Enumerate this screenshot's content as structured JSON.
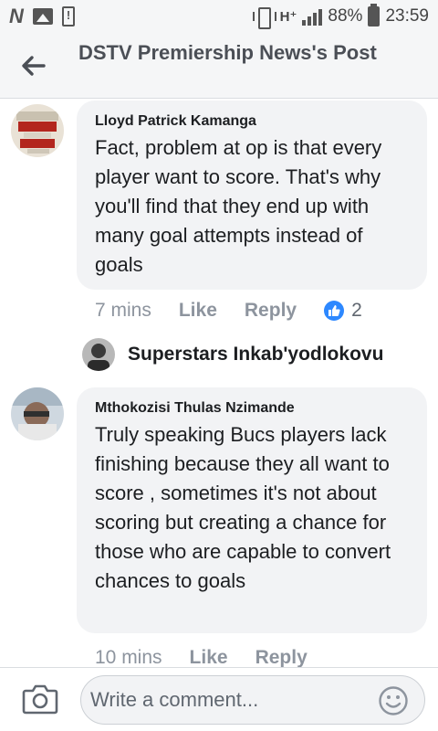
{
  "status_bar": {
    "n_icon": "N",
    "network": "H⁺",
    "battery": "88%",
    "time": "23:59"
  },
  "header": {
    "title": "DSTV Premiership News's Post",
    "back_icon": "arrow-left-icon"
  },
  "comments": [
    {
      "author": "Lloyd Patrick Kamanga",
      "text": "Fact, problem at op is that every player want to score.  That's why you'll find that they end up with many goal attempts instead of goals",
      "time": "7 mins",
      "like_label": "Like",
      "reply_label": "Reply",
      "like_count": "2"
    },
    {
      "author": "Mthokozisi Thulas Nzimande",
      "text": "Truly speaking Bucs players lack finishing because they all want to score , sometimes it's not about scoring but creating a chance for those who are capable to convert chances to goals",
      "time": "10 mins",
      "like_label": "Like",
      "reply_label": "Reply"
    }
  ],
  "typing": {
    "name": "Superstars Inkab'yodlokovu"
  },
  "footer": {
    "placeholder": "Write a comment...",
    "camera_icon": "camera-icon",
    "emoji_icon": "smiley-icon"
  },
  "colors": {
    "accent": "#2d88ff",
    "bubble": "#f2f3f5",
    "muted": "#8d949e"
  }
}
